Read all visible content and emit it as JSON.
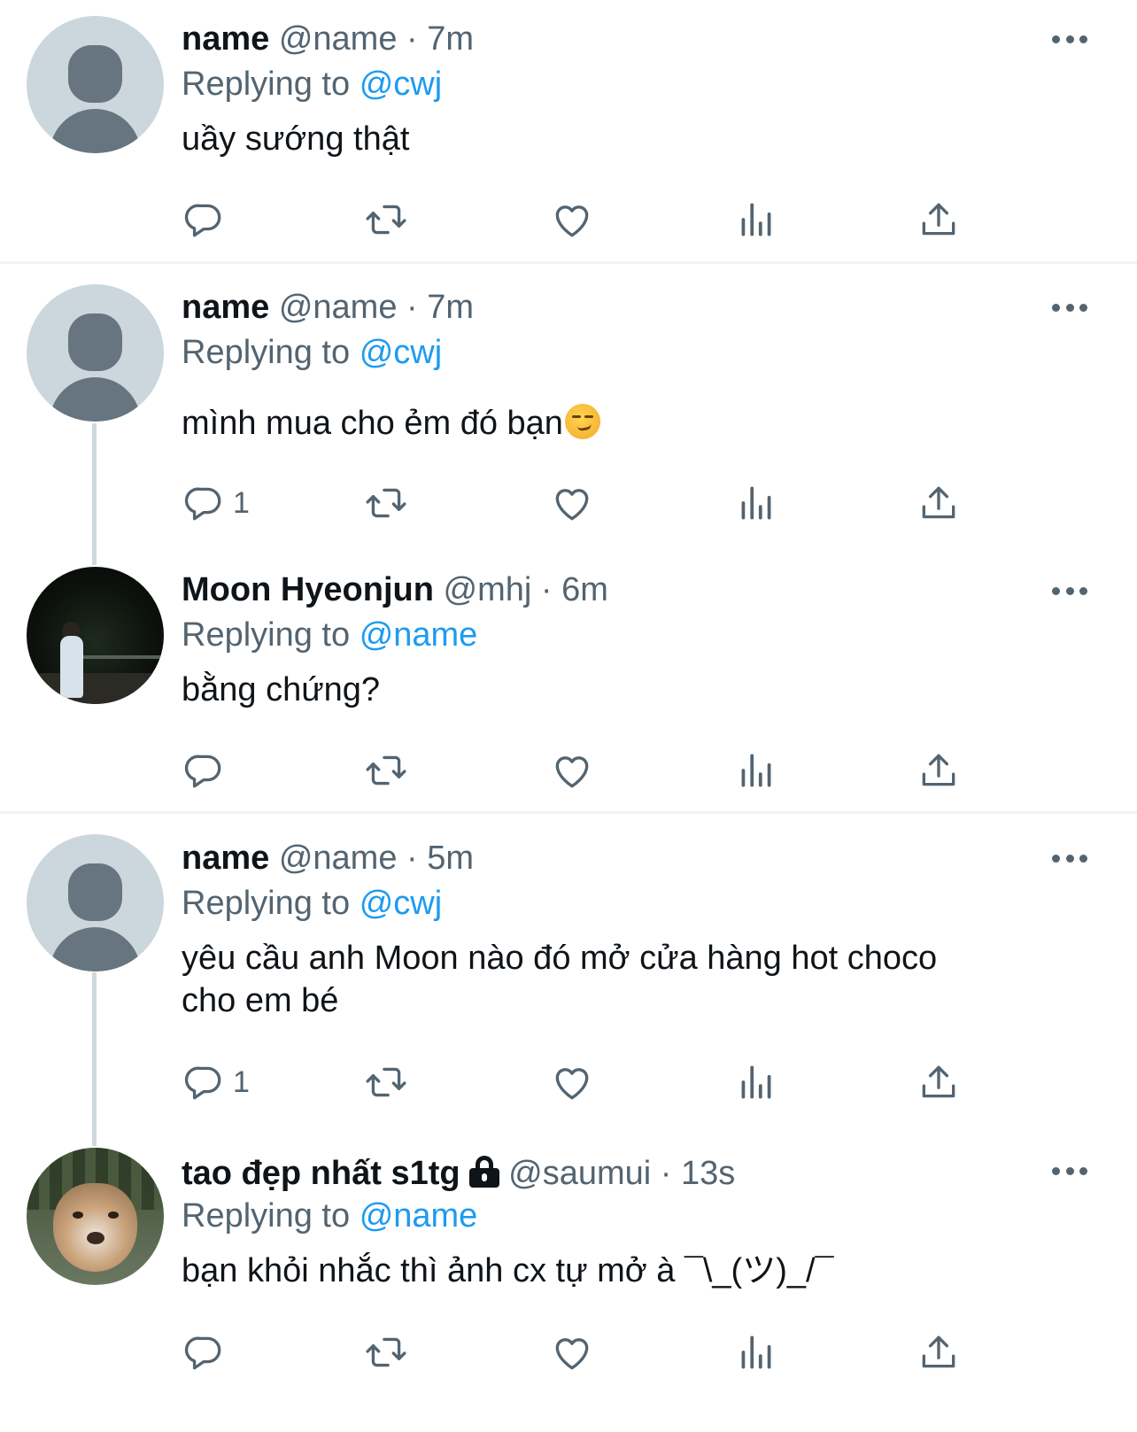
{
  "tweets": [
    {
      "name": "name",
      "handle": "@name",
      "separator": "·",
      "time": "7m",
      "reply_prefix": "Replying to",
      "reply_to": "@cwj",
      "text": "uầy sướng thật",
      "reply_count": "",
      "avatar": "default-avatar"
    },
    {
      "name": "name",
      "handle": "@name",
      "separator": "·",
      "time": "7m",
      "reply_prefix": "Replying to",
      "reply_to": "@cwj",
      "text": "mình mua cho ẻm đó bạn",
      "emoji": "smirking-face",
      "reply_count": "1",
      "avatar": "default-avatar"
    },
    {
      "name": "Moon Hyeonjun",
      "handle": "@mhj",
      "separator": "·",
      "time": "6m",
      "reply_prefix": "Replying to",
      "reply_to": "@name",
      "text": "bằng chứng?",
      "reply_count": "",
      "avatar": "photo-person-beach-night"
    },
    {
      "name": "name",
      "handle": "@name",
      "separator": "·",
      "time": "5m",
      "reply_prefix": "Replying to",
      "reply_to": "@cwj",
      "text_line1": "yêu cầu anh Moon nào đó mở cửa hàng hot choco",
      "text_line2": "cho em bé",
      "reply_count": "1",
      "avatar": "default-avatar"
    },
    {
      "name": "tao đẹp nhất s1tg",
      "protected_icon": "lock-icon",
      "handle": "@saumui",
      "separator": "·",
      "time": "13s",
      "reply_prefix": "Replying to",
      "reply_to": "@name",
      "text": "bạn khỏi nhắc thì ảnh cx tự mở à ¯\\_(ツ)_/¯",
      "reply_count": "",
      "avatar": "photo-tiger"
    }
  ],
  "icons": {
    "reply": "reply-icon",
    "retweet": "retweet-icon",
    "like": "heart-icon",
    "views": "views-icon",
    "share": "share-icon",
    "more": "more-icon"
  },
  "colors": {
    "text": "#0f1419",
    "secondary": "#536471",
    "link": "#1d9bf0",
    "divider": "#eff3f4",
    "thread_line": "#cfd9de"
  }
}
